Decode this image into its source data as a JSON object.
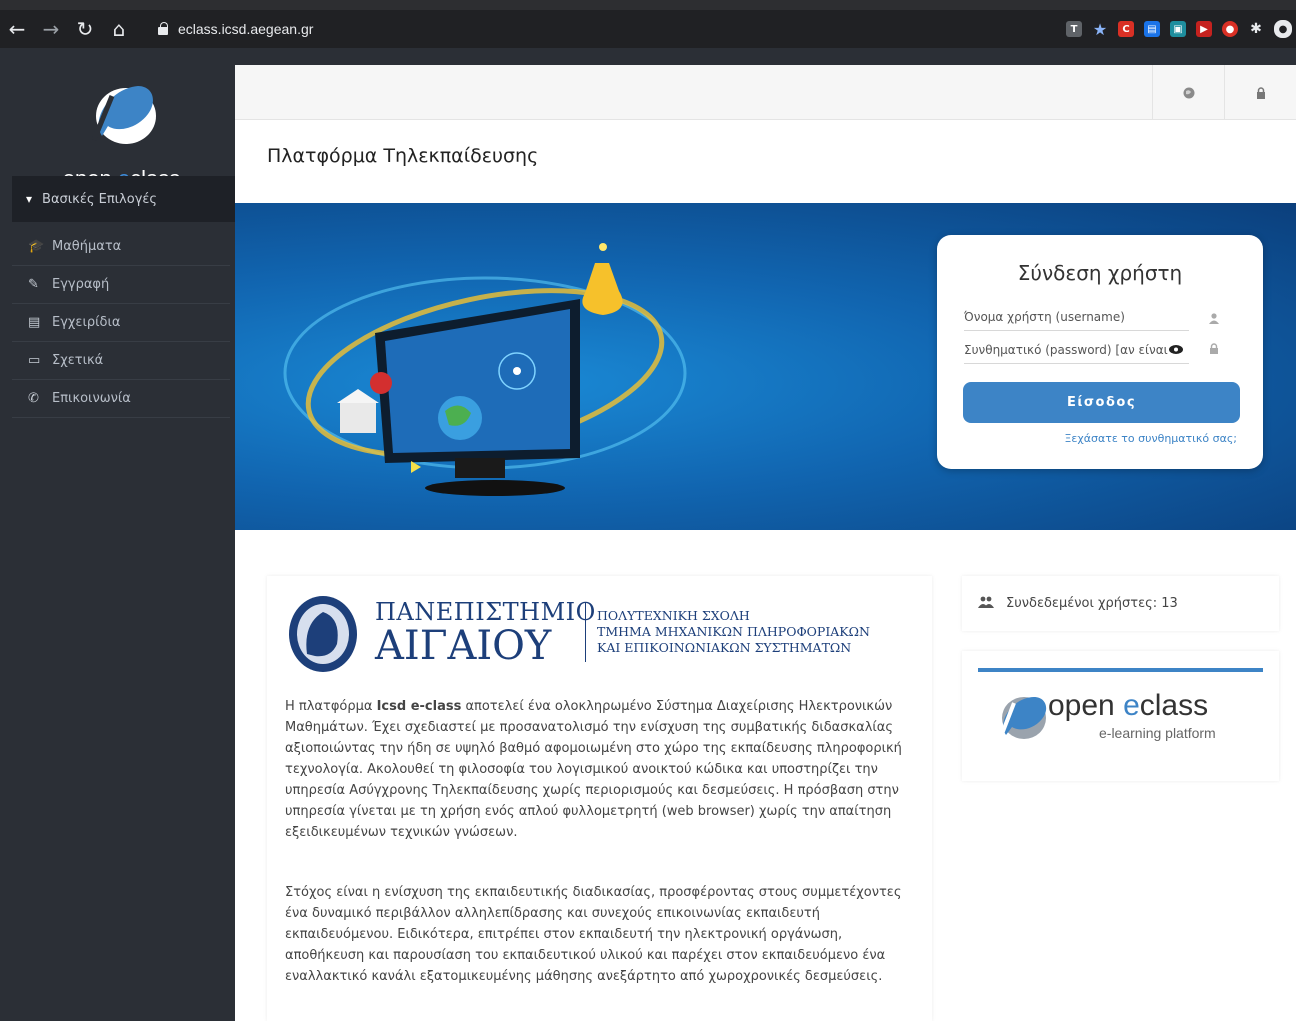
{
  "browser": {
    "url": "eclass.icsd.aegean.gr"
  },
  "sidebar": {
    "logo_prefix": "open ",
    "logo_e": "e",
    "logo_suffix": "class",
    "section_title": "Βασικές Επιλογές",
    "items": [
      {
        "label": "Μαθήματα",
        "icon": "graduation-cap-icon"
      },
      {
        "label": "Εγγραφή",
        "icon": "edit-icon"
      },
      {
        "label": "Εγχειρίδια",
        "icon": "file-icon"
      },
      {
        "label": "Σχετικά",
        "icon": "card-icon"
      },
      {
        "label": "Επικοινωνία",
        "icon": "phone-icon"
      }
    ]
  },
  "main": {
    "page_title": "Πλατφόρμα Τηλεκπαίδευσης"
  },
  "login": {
    "title": "Σύνδεση χρήστη",
    "username_placeholder": "Όνομα χρήστη (username)",
    "password_placeholder": "Συνθηματικό (password) [αν είναι",
    "submit_label": "Είσοδος",
    "forgot_link": "Ξεχάσατε το συνθηματικό σας;"
  },
  "university": {
    "name_line1": "ΠΑΝΕΠΙΣΤΗΜΙΟ",
    "name_line2": "ΑΙΓΑΙΟΥ",
    "school": "ΠΟΛΥΤΕΧΝΙΚΗ ΣΧΟΛΗ",
    "dept_line1": "ΤΜΗΜΑ ΜΗΧΑΝΙΚΩΝ ΠΛΗΡΟΦΟΡΙΑΚΩΝ",
    "dept_line2": "ΚΑΙ ΕΠΙΚΟΙΝΩΝΙΑΚΩΝ ΣΥΣΤΗΜΑΤΩΝ"
  },
  "intro": {
    "p1_before": "Η πλατφόρμα ",
    "p1_bold": "Icsd e-class",
    "p1_after": " αποτελεί ένα ολοκληρωμένο Σύστημα Διαχείρισης Ηλεκτρονικών Μαθημάτων. Έχει σχεδιαστεί με προσανατολισμό την ενίσχυση της συμβατικής διδασκαλίας αξιοποιώντας την ήδη σε υψηλό βαθμό αφομοιωμένη στο χώρο της εκπαίδευσης πληροφορική τεχνολογία. Ακολουθεί τη φιλοσοφία του λογισμικού ανοικτού κώδικα και υποστηρίζει την υπηρεσία Ασύγχρονης Τηλεκπαίδευσης χωρίς περιορισμούς και δεσμεύσεις. Η πρόσβαση στην υπηρεσία γίνεται με τη χρήση ενός απλού φυλλομετρητή (web browser) χωρίς την απαίτηση εξειδικευμένων τεχνικών γνώσεων.",
    "p2": "Στόχος είναι η ενίσχυση της εκπαιδευτικής διαδικασίας, προσφέροντας στους συμμετέχοντες ένα δυναμικό περιβάλλον αλληλεπίδρασης και συνεχούς επικοινωνίας εκπαιδευτή εκπαιδευόμενου. Ειδικότερα, επιτρέπει στον εκπαιδευτή την ηλεκτρονική οργάνωση, αποθήκευση και παρουσίαση του εκπαιδευτικού υλικού και παρέχει στον εκπαιδευόμενο ένα εναλλακτικό κανάλι εξατομικευμένης μάθησης ανεξάρτητο από χωροχρονικές δεσμεύσεις."
  },
  "online": {
    "label": "Συνδεδεμένοι χρήστες: 13"
  },
  "brand": {
    "name_prefix": "open ",
    "name_e": "e",
    "name_suffix": "class",
    "tagline": "e-learning platform"
  }
}
